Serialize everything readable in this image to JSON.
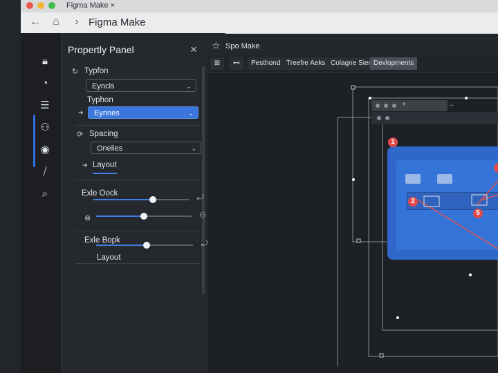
{
  "browser": {
    "tab_title": "Figma Make ×",
    "address": "Figma Make",
    "traffic_light_colors": [
      "#e9574f",
      "#f2b637",
      "#3fbe50"
    ]
  },
  "rail": {
    "icons": [
      "lock-icon",
      "clock-icon",
      "list-icon",
      "component-icon",
      "target-icon",
      "code-icon",
      "search-icon"
    ]
  },
  "panel": {
    "title": "Propertly Panel",
    "close": "×",
    "typography_label": "Typfon",
    "typography_select": "Eyncls",
    "typography_label2": "Typhon",
    "typography_active_select": "Eynnes",
    "spacing_label": "Spacing",
    "spacing_select": "Onelies",
    "layout_label": "Layout",
    "slider1_label": "Exle Oock",
    "slider1_value": 0.62,
    "slider2_value": 0.5,
    "slider3_label": "Exle Bopk",
    "slider3_value": 0.52,
    "layout_label2": "Layout"
  },
  "canvas": {
    "title": "Spo Make",
    "tabs": [
      "Pesthond",
      "Treefre Aeks",
      "Colagne Siere",
      "Devlopments"
    ],
    "active_tab": "Devlopments",
    "badges": [
      "1",
      "2",
      "5"
    ],
    "accent_color": "#3474d8",
    "badge_color": "#e24b4b"
  }
}
